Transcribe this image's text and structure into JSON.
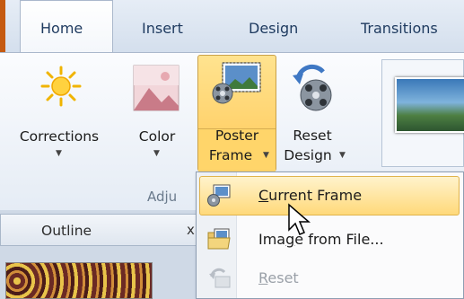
{
  "tabs": [
    "Home",
    "Insert",
    "Design",
    "Transitions"
  ],
  "ribbon": {
    "corrections_label": "Corrections",
    "color_label": "Color",
    "poster_frame_line1": "Poster",
    "poster_frame_line2": "Frame",
    "reset_design_line1": "Reset",
    "reset_design_line2": "Design",
    "group_label_visible": "Adju"
  },
  "panel": {
    "outline_tab": "Outline"
  },
  "menu": {
    "items": [
      {
        "pre": "",
        "accel": "C",
        "post": "urrent Frame",
        "icon": "current-frame-icon",
        "enabled": true,
        "highlighted": true
      },
      {
        "pre": "Ima",
        "accel": "g",
        "post": "e from File...",
        "icon": "image-from-file-icon",
        "enabled": true,
        "highlighted": false
      },
      {
        "pre": "",
        "accel": "R",
        "post": "eset",
        "icon": "reset-icon",
        "enabled": false,
        "highlighted": false
      }
    ]
  },
  "colors": {
    "highlight": "#ffd97a",
    "file_tab_orange": "#c55a11",
    "ribbon_text": "#1e3a5f"
  }
}
